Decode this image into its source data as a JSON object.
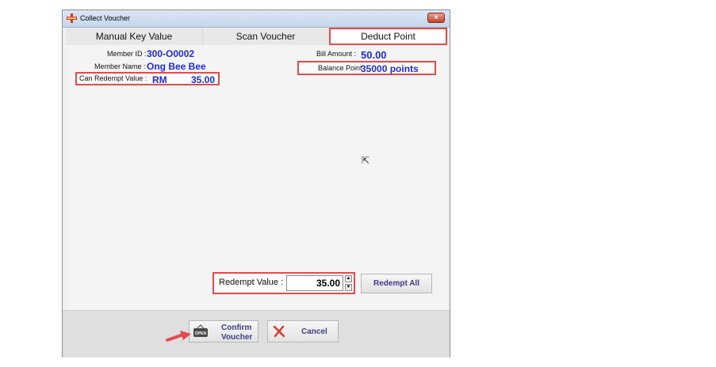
{
  "window": {
    "title": "Collect Voucher",
    "close_label": "×"
  },
  "tabs": [
    {
      "label": "Manual Key Value"
    },
    {
      "label": "Scan Voucher"
    },
    {
      "label": "Deduct Point"
    }
  ],
  "details": {
    "member_id_label": "Member ID :",
    "member_id_value": "300-O0002",
    "member_name_label": "Member Name :",
    "member_name_value": "Ong Bee Bee",
    "can_redempt_label": "Can Redempt Value :",
    "can_redempt_currency": "RM",
    "can_redempt_value": "35.00",
    "bill_amount_label": "Bill Amount :",
    "bill_amount_value": "50.00",
    "balance_point_label": "Balance Point :",
    "balance_point_value": "35000 points"
  },
  "redempt": {
    "label": "Redempt  Value :",
    "value": "35.00",
    "redempt_all_label": "Redempt All"
  },
  "actions": {
    "confirm_line1": "Confirm",
    "confirm_line2": "Voucher",
    "confirm_icon_text": "OPEN",
    "cancel_label": "Cancel"
  },
  "colors": {
    "highlight": "#e14b4b",
    "value_blue": "#1f2bd6"
  }
}
